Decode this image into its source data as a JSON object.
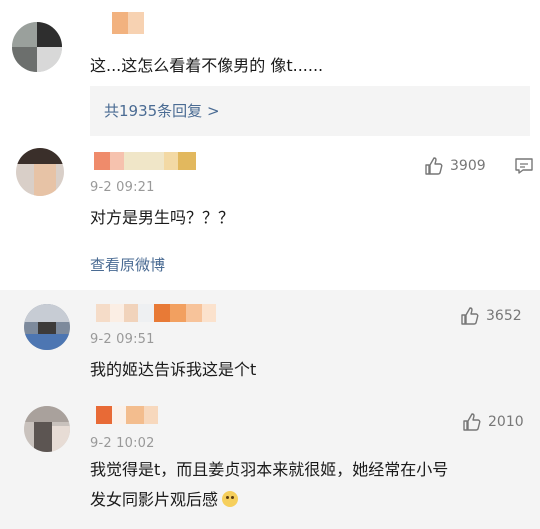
{
  "comment1": {
    "text": "这...这怎么看着不像男的 像t......",
    "replies_link": "共1935条回复 >"
  },
  "comment2": {
    "time": "9-2 09:21",
    "likes": "3909",
    "text": "对方是男生吗？？？",
    "view_original": "查看原微博"
  },
  "comment3": {
    "time": "9-2 09:51",
    "likes": "3652",
    "text": "我的姬达告诉我这是个t"
  },
  "comment4": {
    "time": "9-2 10:02",
    "likes": "2010",
    "text_line1": "我觉得是t，而且姜贞羽本来就很姬，她经常在小号",
    "text_line2": "发女同影片观后感"
  },
  "icons": [
    "thumb-up-icon",
    "comment-icon",
    "emoji-smile-icon"
  ],
  "colors": {
    "link": "#4a6b93",
    "time": "#999999",
    "gray_bg": "#f4f4f4"
  }
}
